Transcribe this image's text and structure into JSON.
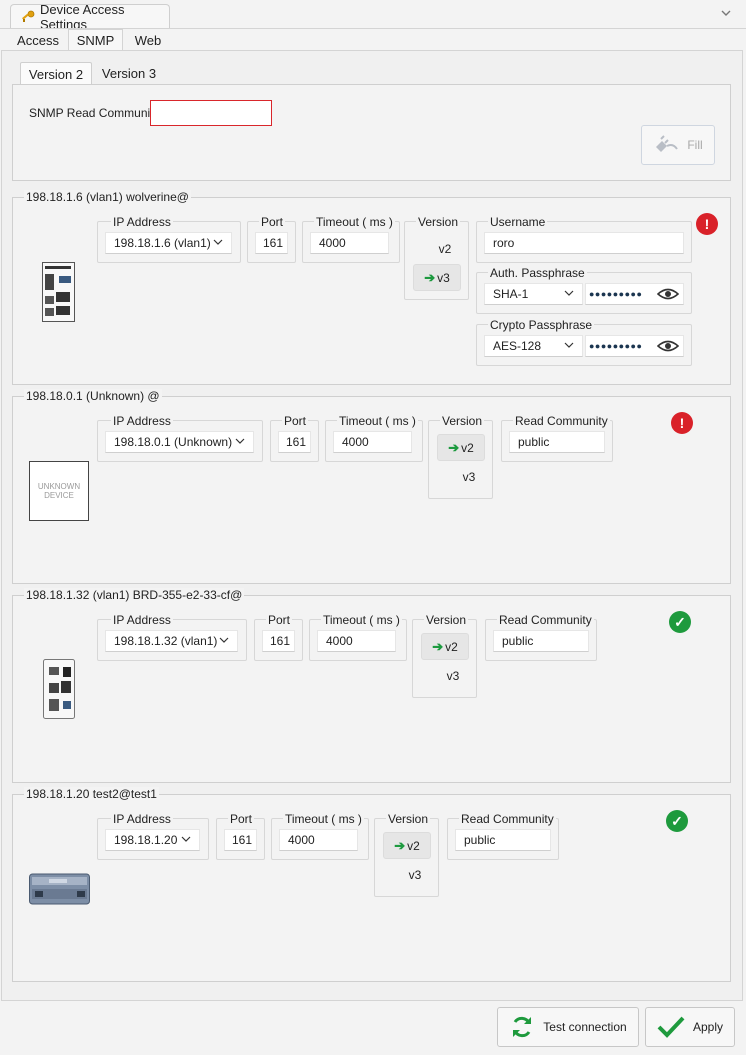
{
  "window": {
    "title": "Device Access Settings"
  },
  "tabs": [
    "Access",
    "SNMP",
    "Web"
  ],
  "version_tabs": [
    "Version 2",
    "Version 3"
  ],
  "snmp_read_community": {
    "label": "SNMP Read Community",
    "value": ""
  },
  "fill_button": {
    "label": "Fill"
  },
  "field_labels": {
    "ip": "IP Address",
    "port": "Port",
    "timeout": "Timeout ( ms )",
    "version": "Version",
    "username": "Username",
    "auth": "Auth. Passphrase",
    "crypto": "Crypto Passphrase",
    "read_community": "Read Community"
  },
  "devices": [
    {
      "title": "198.18.1.6 (vlan1) wolverine@",
      "ip": "198.18.1.6 (vlan1)",
      "port": "161",
      "timeout": "4000",
      "v2_label": "v2",
      "v3_label": "v3",
      "selected_version": "v3",
      "username": "roro",
      "auth_protocol": "SHA-1",
      "auth_pass": "●●●●●●●●●",
      "crypto_protocol": "AES-128",
      "crypto_pass": "●●●●●●●●●",
      "status": "error"
    },
    {
      "title": "198.18.0.1 (Unknown) @",
      "ip": "198.18.0.1 (Unknown)",
      "port": "161",
      "timeout": "4000",
      "v2_label": "v2",
      "v3_label": "v3",
      "selected_version": "v2",
      "read_community": "public",
      "unknown_text": [
        "UNKNOWN",
        "DEVICE"
      ],
      "status": "error"
    },
    {
      "title": "198.18.1.32 (vlan1) BRD-355-e2-33-cf@",
      "ip": "198.18.1.32 (vlan1)",
      "port": "161",
      "timeout": "4000",
      "v2_label": "v2",
      "v3_label": "v3",
      "selected_version": "v2",
      "read_community": "public",
      "status": "ok"
    },
    {
      "title": "198.18.1.20 test2@test1",
      "ip": "198.18.1.20",
      "port": "161",
      "timeout": "4000",
      "v2_label": "v2",
      "v3_label": "v3",
      "selected_version": "v2",
      "read_community": "public",
      "status": "ok"
    }
  ],
  "buttons": {
    "test": "Test connection",
    "apply": "Apply"
  },
  "icons": {
    "title": "key-icon",
    "collapse": "chevron-down-icon",
    "fill": "plug-icon",
    "eye": "eye-icon",
    "test": "refresh-icon",
    "apply": "checkmark-icon"
  },
  "colors": {
    "error": "#d92129",
    "ok": "#1e9a3d",
    "arrow": "#1d9a3f",
    "invalid_border": "#d9262b"
  }
}
